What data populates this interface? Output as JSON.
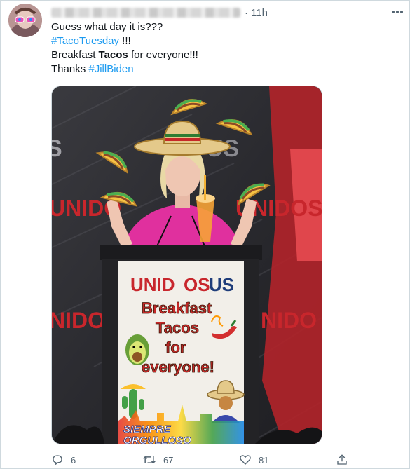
{
  "tweet": {
    "author_name": "",
    "time": "11h",
    "text_line1": "Guess what day it is???",
    "hashtag_taco": "#TacoTuesday",
    "exclaim": " !!!",
    "line3_pre": "Breakfast ",
    "line3_bold": "Tacos",
    "line3_post": " for everyone!!!",
    "line4_pre": "Thanks ",
    "hashtag_biden": "#JillBiden"
  },
  "media": {
    "backdrop_brand_left": "UNIDOSUS",
    "podium_brand_a": "UNID",
    "podium_brand_b": "OS",
    "podium_brand_c": "US",
    "sign_line1": "Breakfast",
    "sign_line2": "Tacos",
    "sign_line3": "for",
    "sign_line4": "everyone!",
    "bottom_text1": "SIEMPRE",
    "bottom_text2": "ORGULLOSO",
    "colors": {
      "backdrop_red": "#c8262c",
      "pink_dress": "#e0309e",
      "brand_blue": "#1f3d7a"
    }
  },
  "actions": {
    "reply_count": "6",
    "retweet_count": "67",
    "like_count": "81"
  },
  "icons": [
    "reply-icon",
    "retweet-icon",
    "like-icon",
    "share-icon",
    "more-icon"
  ]
}
